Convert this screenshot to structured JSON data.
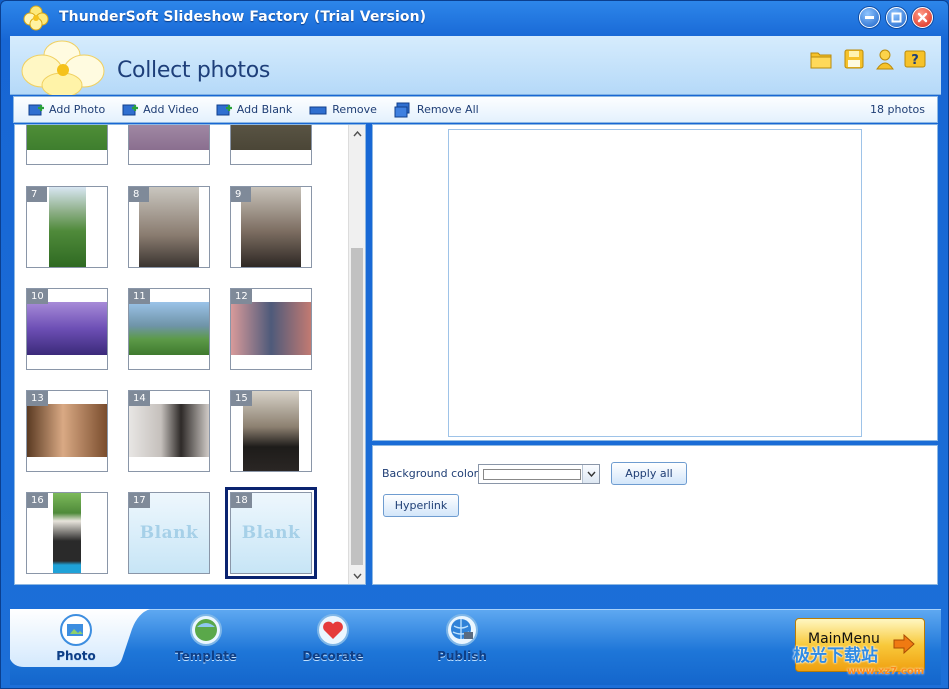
{
  "window": {
    "title": "ThunderSoft Slideshow Factory (Trial Version)"
  },
  "header": {
    "title": "Collect photos",
    "icons": [
      "folder-icon",
      "save-icon",
      "user-icon",
      "help-icon"
    ]
  },
  "toolbar": {
    "add_photo": "Add Photo",
    "add_video": "Add Video",
    "add_blank": "Add Blank",
    "remove": "Remove",
    "remove_all": "Remove All",
    "photo_count": "18 photos"
  },
  "thumbnails": [
    {
      "num": "7"
    },
    {
      "num": "8"
    },
    {
      "num": "9"
    },
    {
      "num": "10"
    },
    {
      "num": "11"
    },
    {
      "num": "12"
    },
    {
      "num": "13"
    },
    {
      "num": "14"
    },
    {
      "num": "15"
    },
    {
      "num": "16"
    },
    {
      "num": "17",
      "blank": "Blank"
    },
    {
      "num": "18",
      "blank": "Blank",
      "selected": true
    }
  ],
  "properties": {
    "background_color_label": "Background color",
    "background_color_value": "#FFFFFF",
    "apply_all": "Apply all",
    "hyperlink": "Hyperlink"
  },
  "tabs": [
    {
      "label": "Photo",
      "active": true
    },
    {
      "label": "Template"
    },
    {
      "label": "Decorate"
    },
    {
      "label": "Publish"
    }
  ],
  "main_menu": {
    "label": "MainMenu"
  },
  "watermark": {
    "text": "极光下载站",
    "sub": "www.xz7.com"
  },
  "colors": {
    "accent": "#1766d4",
    "selection": "#0a2370",
    "mainmenu": "#f8c93b"
  }
}
